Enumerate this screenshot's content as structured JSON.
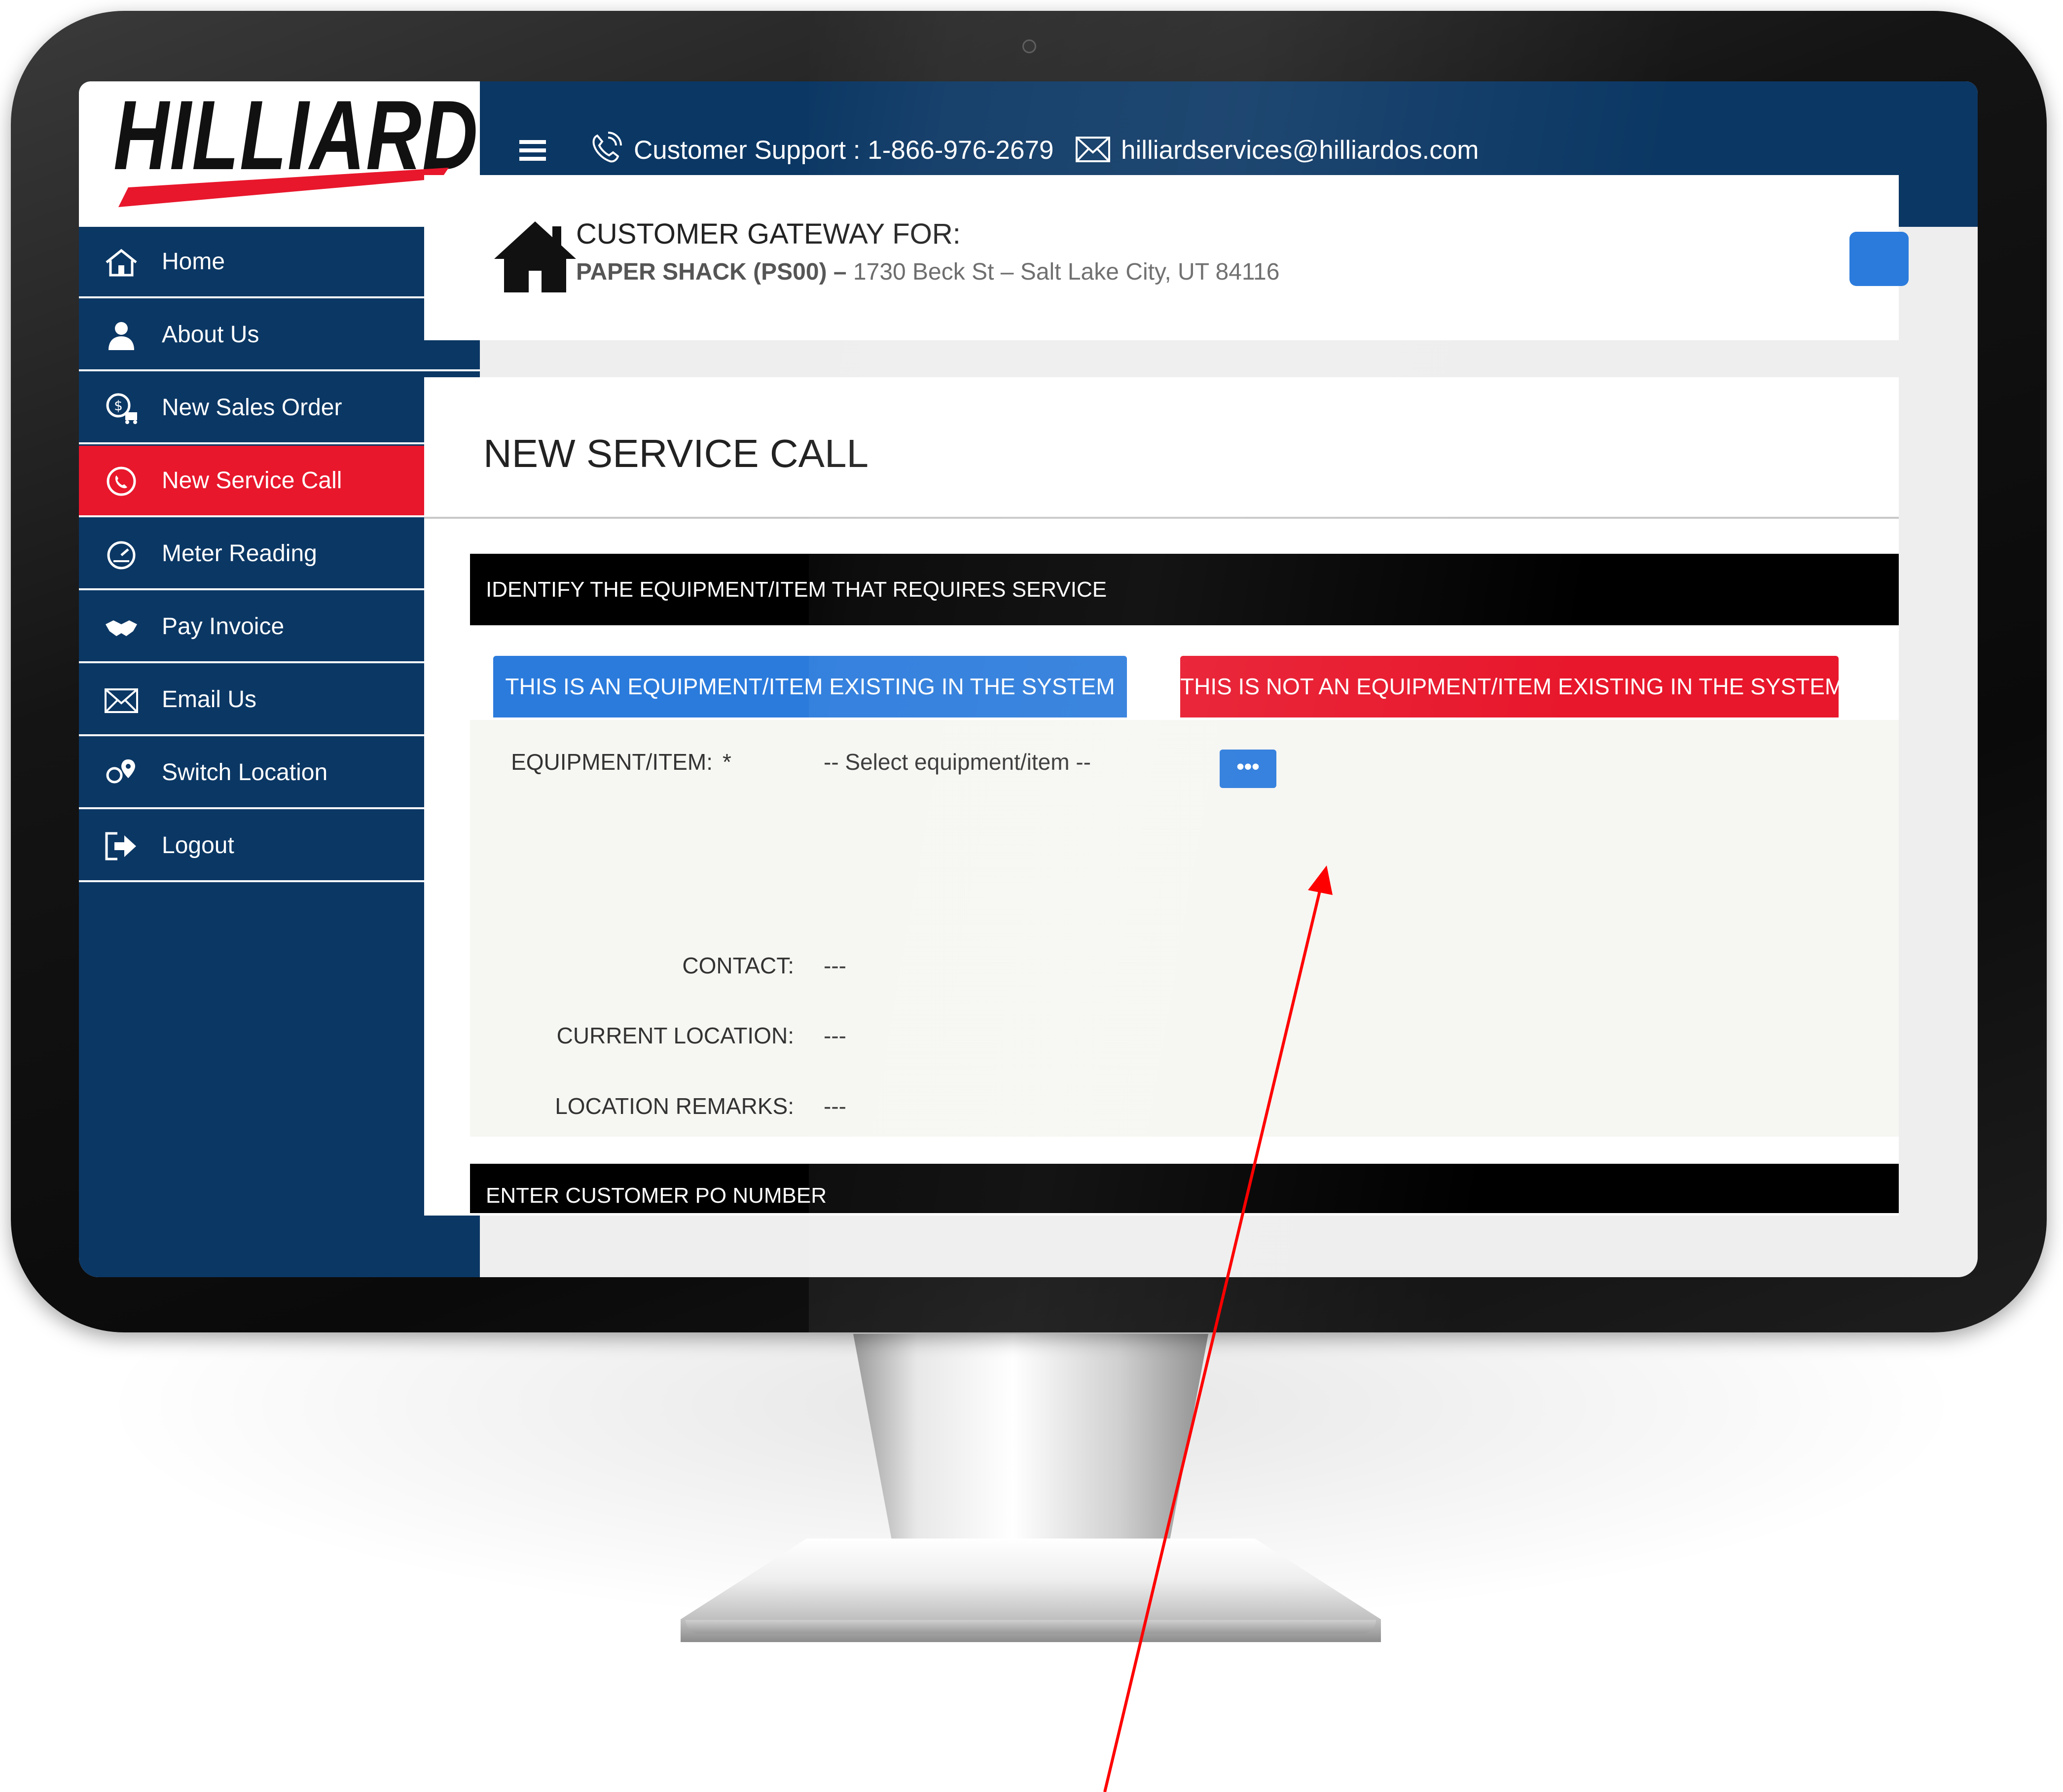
{
  "header": {
    "logo_text": "HILLIARD",
    "support_label": "Customer Support : 1-866-976-2679",
    "email": "hilliardservices@hilliardos.com"
  },
  "sidebar": {
    "items": [
      {
        "label": "Home",
        "icon": "home-icon"
      },
      {
        "label": "About Us",
        "icon": "user-icon"
      },
      {
        "label": "New Sales Order",
        "icon": "sales-order-icon"
      },
      {
        "label": "New Service Call",
        "icon": "service-call-icon",
        "active": true
      },
      {
        "label": "Meter Reading",
        "icon": "meter-icon"
      },
      {
        "label": "Pay Invoice",
        "icon": "handshake-icon"
      },
      {
        "label": "Email Us",
        "icon": "envelope-icon"
      },
      {
        "label": "Switch Location",
        "icon": "location-icon"
      },
      {
        "label": "Logout",
        "icon": "logout-icon"
      }
    ]
  },
  "gateway": {
    "title": "CUSTOMER GATEWAY FOR:",
    "customer": "PAPER SHACK (PS00)",
    "separator": " – ",
    "address": "1730 Beck St – Salt Lake City, UT 84116"
  },
  "main": {
    "page_title": "NEW SERVICE CALL",
    "section_title": "IDENTIFY THE EQUIPMENT/ITEM THAT REQUIRES SERVICE",
    "btn_existing": "THIS IS AN EQUIPMENT/ITEM EXISTING IN THE SYSTEM",
    "btn_not_existing": "THIS IS NOT AN EQUIPMENT/ITEM EXISTING IN THE SYSTEM",
    "fields": {
      "equipment_label": "EQUIPMENT/ITEM:",
      "required_mark": "*",
      "equipment_value": "-- Select equipment/item --",
      "ellipsis": "•••",
      "contact_label": "CONTACT:",
      "contact_value": "---",
      "location_label": "CURRENT LOCATION:",
      "location_value": "---",
      "remarks_label": "LOCATION REMARKS:",
      "remarks_value": "---"
    },
    "next_section_title": "ENTER CUSTOMER PO NUMBER"
  },
  "colors": {
    "navy": "#0b3764",
    "red": "#e8172c",
    "blue": "#2b7bdc",
    "annotation": "#ff0000"
  }
}
